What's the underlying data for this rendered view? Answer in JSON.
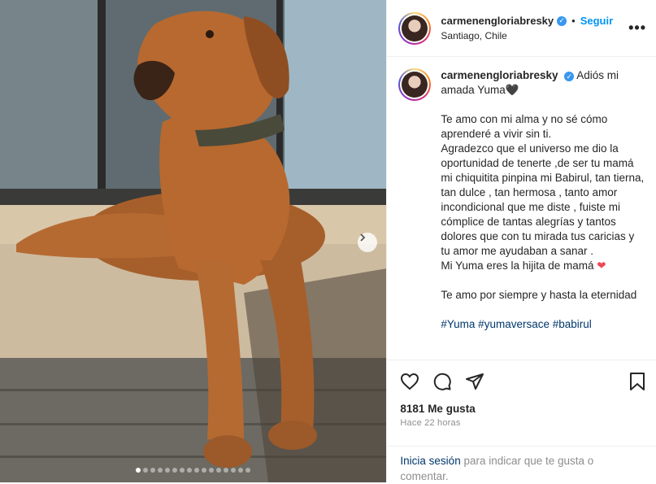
{
  "post": {
    "username": "carmenengloriabresky",
    "follow_label": "Seguir",
    "separator": "•",
    "location": "Santiago, Chile",
    "more_label": "•••"
  },
  "caption": {
    "username": "carmenengloriabresky",
    "line_first": "Adiós mi amada Yuma🖤",
    "paragraph_1": "Te amo con mi alma y no sé cómo aprenderé a vivir sin ti.",
    "paragraph_2": "Agradezco que el universo me dio la oportunidad de tenerte ,de ser tu mamá mi chiquitita pinpina mi Babirul, tan tierna, tan dulce , tan hermosa , tanto amor incondicional que me diste , fuiste mi cómplice de tantas alegrías y tantos dolores que con tu mirada tus caricias y tu amor me ayudaban a sanar .",
    "paragraph_3": "Mi Yuma eres la hijita de mamá",
    "heart": "❤",
    "paragraph_4": "Te amo por siempre y hasta la eternidad",
    "hashtags": "#Yuma #yumaversace #babirul"
  },
  "stats": {
    "likes": "8181 Me gusta",
    "time": "Hace 22 horas"
  },
  "login": {
    "link": "Inicia sesión",
    "rest": " para indicar que te gusta o comentar."
  },
  "carousel": {
    "total_slides": 16,
    "active_index": 0
  }
}
